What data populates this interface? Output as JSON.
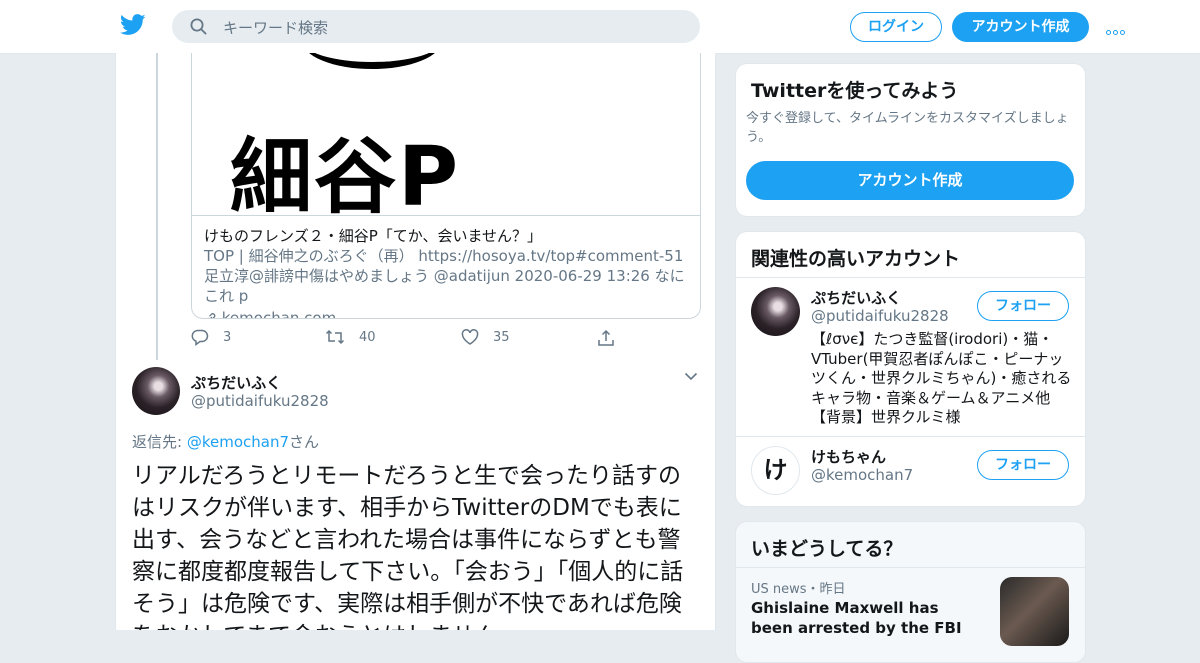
{
  "header": {
    "search_placeholder": "キーワード検索",
    "login_label": "ログイン",
    "signup_label": "アカウント作成"
  },
  "colors": {
    "accent": "#1da1f2",
    "background": "#e6ecf0",
    "muted": "#657786"
  },
  "quoted_card": {
    "image_text": "細谷P",
    "title": "けものフレンズ２・細谷P「てか、会いません？」",
    "description": "TOP | 細谷伸之のぶろぐ（再） https://hosoya.tv/top#comment-51 足立淳@誹謗中傷はやめましょう @adatijun 2020-06-29 13:26 なにこれ p",
    "domain": "kemochan.com"
  },
  "actions": {
    "replies": "3",
    "retweets": "40",
    "likes": "35"
  },
  "tweet": {
    "name": "ぷちだいふく",
    "handle": "@putidaifuku2828",
    "reply_prefix": "返信先: ",
    "reply_to": "@kemochan7",
    "reply_suffix": "さん",
    "text": "リアルだろうとリモートだろうと生で会ったり話すのはリスクが伴います、相手からTwitterのDMでも表に出す、会うなどと言われた場合は事件にならずとも警察に都度都度報告して下さい。「会おう」「個人的に話そう」は危険です、実際は相手側が不快であれば危険をおかしてまで会おうとはしません。"
  },
  "signup_panel": {
    "title": "Twitterを使ってみよう",
    "subtitle": "今すぐ登録して、タイムラインをカスタマイズしましょう。",
    "button": "アカウント作成"
  },
  "related": {
    "title": "関連性の高いアカウント",
    "follow_label": "フォロー",
    "accounts": [
      {
        "name": "ぷちだいふく",
        "handle": "@putidaifuku2828",
        "bio": "【ℓσνє】たつき監督(irodori)・猫・VTuber(甲賀忍者ぽんぽこ・ピーナッツくん・世界クルミちゃん)・癒されるキャラ物・音楽＆ゲーム＆アニメ他【背景】世界クルミ様"
      },
      {
        "name": "けもちゃん",
        "handle": "@kemochan7",
        "avatar_char": "け"
      }
    ]
  },
  "trends": {
    "title": "いまどうしてる？",
    "meta": "US news・昨日",
    "headline": "Ghislaine Maxwell has been arrested by the FBI"
  }
}
